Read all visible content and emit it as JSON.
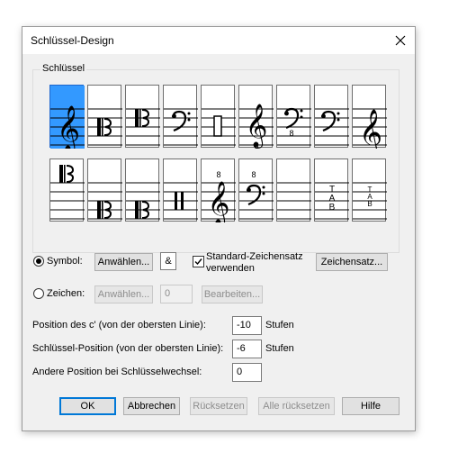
{
  "window": {
    "title": "Schlüssel-Design"
  },
  "group": {
    "label": "Schlüssel"
  },
  "clefs": {
    "row1": [
      "treble-clef",
      "alto-clef",
      "tenor-clef",
      "bass-clef",
      "percussion-clef",
      "treble-8vb-clef",
      "bass-8vb-clef",
      "bass-clef-alt",
      "treble-clef-alt"
    ],
    "row2": [
      "c-clef-high",
      "c-clef-low",
      "c-clef-lower",
      "percussion-clef-alt",
      "treble-8va-clef",
      "bass-8va-clef",
      "blank-clef",
      "tab-clef",
      "tab-clef-small"
    ],
    "selected": "treble-clef"
  },
  "symbol": {
    "radio_label": "Symbol:",
    "select_label": "Anwählen...",
    "char": "&",
    "checkbox_label_line1": "Standard-Zeichensatz",
    "checkbox_label_line2": "verwenden",
    "font_button": "Zeichensatz..."
  },
  "zeichen": {
    "radio_label": "Zeichen:",
    "select_label": "Anwählen...",
    "value": "0",
    "edit_label": "Bearbeiten..."
  },
  "position_c": {
    "label": "Position des c' (von der obersten Linie):",
    "value": "-10",
    "unit": "Stufen"
  },
  "clef_position": {
    "label": "Schlüssel-Position (von der obersten Linie):",
    "value": "-6",
    "unit": "Stufen"
  },
  "other_position": {
    "label": "Andere Position bei Schlüsselwechsel:",
    "value": "0"
  },
  "buttons": {
    "ok": "OK",
    "cancel": "Abbrechen",
    "reset": "Rücksetzen",
    "reset_all": "Alle rücksetzen",
    "help": "Hilfe"
  },
  "glyphs": {
    "tab_letters": [
      "T",
      "A",
      "B"
    ],
    "octave_mark": "8"
  }
}
